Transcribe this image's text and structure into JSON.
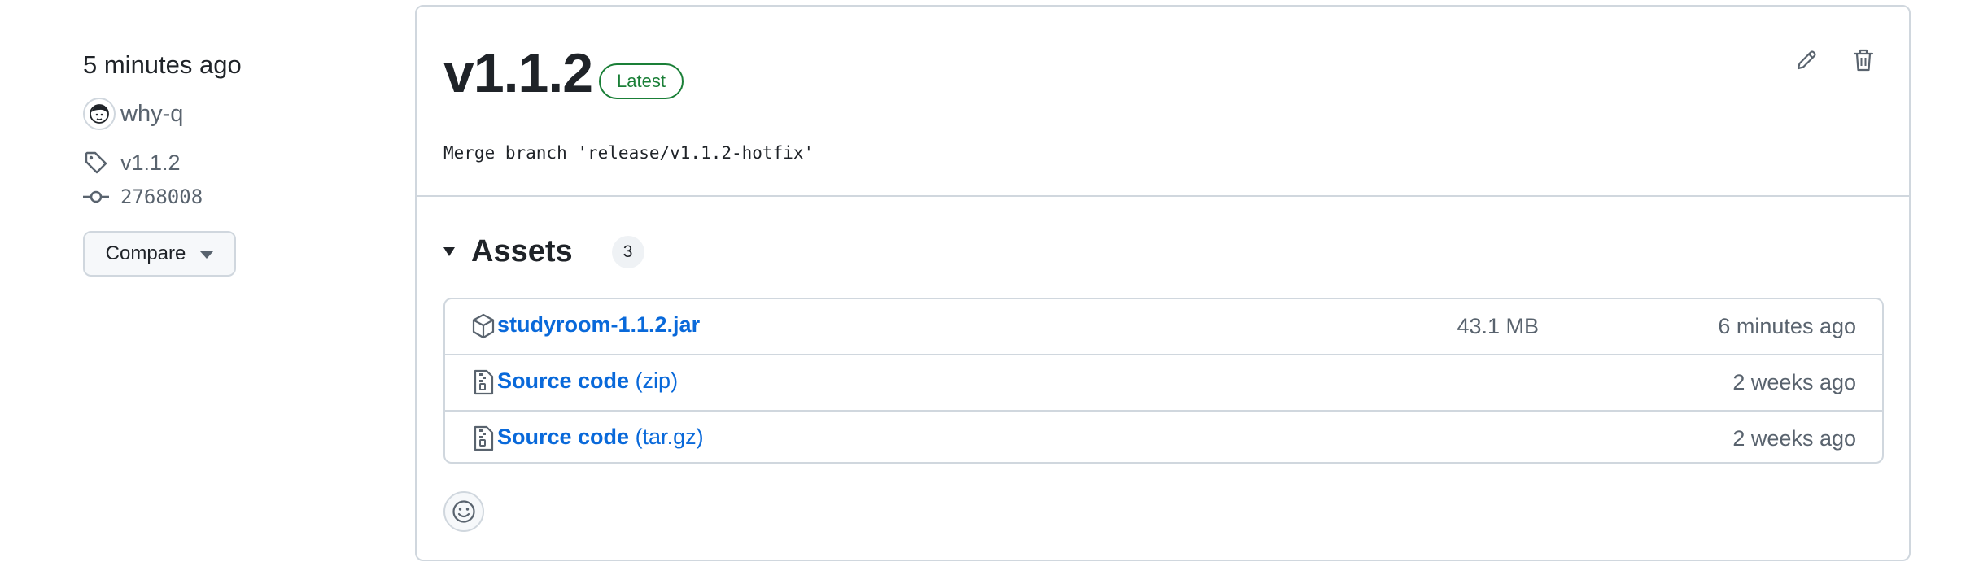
{
  "sidebar": {
    "time_ago": "5 minutes ago",
    "author": "why-q",
    "tag": "v1.1.2",
    "commit": "2768008",
    "compare_label": "Compare"
  },
  "release": {
    "title": "v1.1.2",
    "badge": "Latest",
    "commit_message": "Merge branch 'release/v1.1.2-hotfix'"
  },
  "assets": {
    "title": "Assets",
    "count": "3",
    "items": [
      {
        "name": "studyroom-1.1.2.jar",
        "suffix": "",
        "size": "43.1 MB",
        "date": "6 minutes ago",
        "icon": "package-icon"
      },
      {
        "name": "Source code",
        "suffix": " (zip)",
        "size": "",
        "date": "2 weeks ago",
        "icon": "file-zip-icon"
      },
      {
        "name": "Source code",
        "suffix": " (tar.gz)",
        "size": "",
        "date": "2 weeks ago",
        "icon": "file-zip-icon"
      }
    ]
  },
  "colors": {
    "link": "#0969da",
    "latest_badge": "#1a7f37",
    "border": "#d0d7de",
    "muted_text": "#59636e"
  }
}
